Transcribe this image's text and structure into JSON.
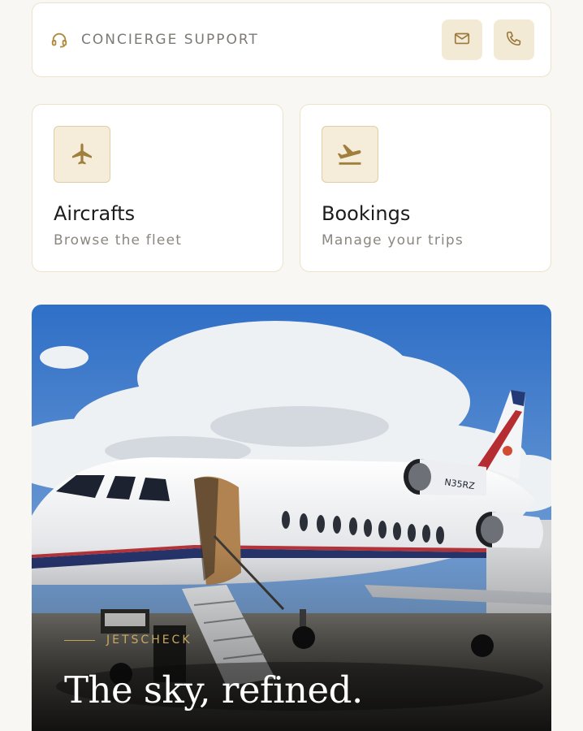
{
  "concierge": {
    "label": "CONCIERGE SUPPORT",
    "icon": "headset-icon",
    "actions": [
      {
        "icon": "mail-icon"
      },
      {
        "icon": "phone-icon"
      }
    ]
  },
  "tiles": [
    {
      "icon": "airplane-icon",
      "title": "Aircrafts",
      "subtitle": "Browse the fleet"
    },
    {
      "icon": "departure-icon",
      "title": "Bookings",
      "subtitle": "Manage your trips"
    }
  ],
  "hero": {
    "brand": "JETSCHECK",
    "tagline": "The sky, refined.",
    "tail_number": "N35RZ"
  },
  "colors": {
    "accent": "#b08a3e",
    "accent_bg": "#f3ead6",
    "border": "#ece3cc",
    "page_bg": "#f8f7f3"
  }
}
